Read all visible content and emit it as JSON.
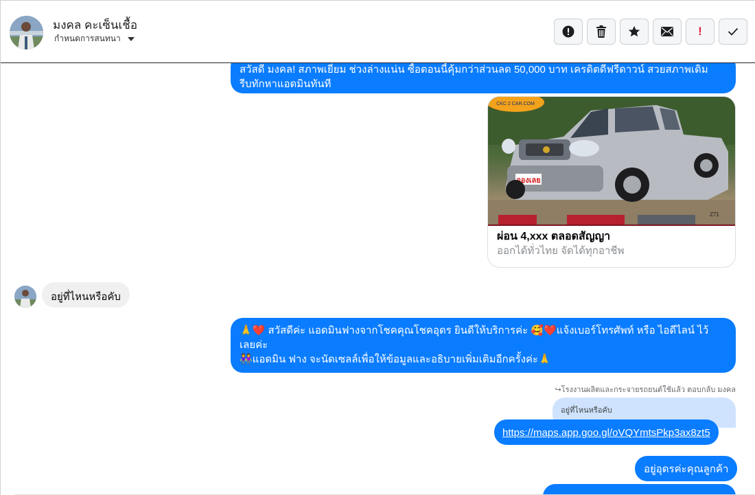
{
  "header": {
    "contact_name": "มงคล คะเซ็นเชื้อ",
    "assign_label": "กำหนดการสนทนา"
  },
  "toolbar": {
    "buttons": [
      {
        "name": "report-spam-button",
        "icon": "alert-circle-icon",
        "label": ""
      },
      {
        "name": "delete-button",
        "icon": "trash-icon",
        "label": ""
      },
      {
        "name": "star-button",
        "icon": "star-icon",
        "label": ""
      },
      {
        "name": "mark-unread-button",
        "icon": "envelope-icon",
        "label": ""
      },
      {
        "name": "follow-up-button",
        "icon": "exclamation-icon",
        "label": "!"
      },
      {
        "name": "mark-done-button",
        "icon": "check-icon",
        "label": ""
      }
    ]
  },
  "messages": {
    "first_out": {
      "line1": "สวัสดี มงคล!  สภาพเยี่ยม ช่วงล่างแน่น  ซื้อตอนนี้คุ้มกว่าส่วนลด 50,000 บาท เครดิตดีฟรีดาวน์  สวยสภาพเดิม",
      "line2": "รีบทักหาแอดมินทันที"
    },
    "card": {
      "title": "ผ่อน 4,xxx ตลอดสัญญา",
      "subtitle": "ออกได้ทั่วไทย จัดได้ทุกอาชีพ",
      "badge_text": "จองเลย",
      "logo_text": "CKC 2 CAR.COM",
      "model_text": "Z71"
    },
    "incoming": {
      "text": "อยู่ที่ไหนหรือคับ"
    },
    "greeting_out": {
      "line1": "🙏❤️ สวัสดีค่ะ แอดมินฟางจากโชคคุณโชคอุดร ยินดีให้บริการค่ะ  🥰❤️แจ้งเบอร์โทรศัพท์ หรือ ไอดีไลน์  ไว้",
      "line2": "เลยค่ะ",
      "line3": "👭แอดมิน ฟาง จะนัดเซลล์เพื่อให้ข้อมูลและอธิบายเพิ่มเติมอีกครั้งค่ะ🙏"
    },
    "reply_note": "↪โรงงานผลิตและกระจายรถยนต์ใช้แล้ว ตอบกลับ มงคล",
    "quoted_text": "อยู่ที่ไหนหรือคับ",
    "link_text": "https://maps.app.goo.gl/oVQYmtsPkp3ax8zt5",
    "last_out": "อยู่อุดรค่ะคุณลูกค้า"
  },
  "colors": {
    "outgoing_bubble": "#0a7cff",
    "incoming_bubble": "#f0f0f0",
    "quoted_bubble": "#cfe3ff",
    "follow_up_red": "#e41e3f"
  }
}
